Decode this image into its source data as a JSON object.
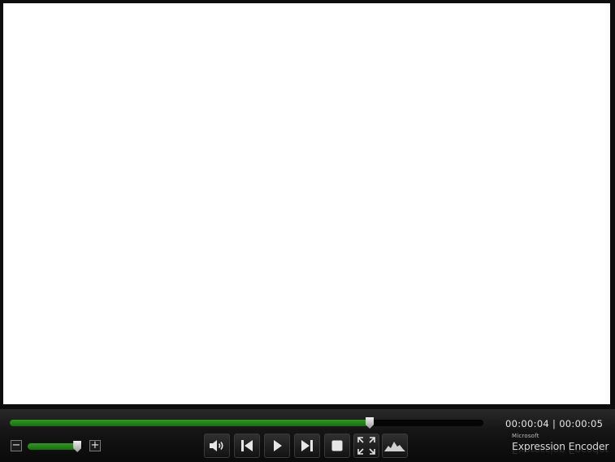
{
  "player": {
    "accent_color": "#2a8f1a",
    "seek": {
      "progress": 0.76
    },
    "time": {
      "current": "00:00:04",
      "separator": "|",
      "total": "00:00:05"
    },
    "volume": {
      "level": 0.9,
      "decrease_symbol": "−",
      "increase_symbol": "+"
    },
    "buttons": [
      {
        "name": "volume-button",
        "icon": "speaker-icon"
      },
      {
        "name": "previous-button",
        "icon": "skip-previous-icon"
      },
      {
        "name": "play-button",
        "icon": "play-icon"
      },
      {
        "name": "next-button",
        "icon": "skip-next-icon"
      },
      {
        "name": "stop-button",
        "icon": "stop-icon"
      },
      {
        "name": "fullscreen-button",
        "icon": "fullscreen-icon"
      },
      {
        "name": "graph-button",
        "icon": "waveform-icon"
      }
    ],
    "brand": {
      "vendor": "Microsoft",
      "product": "Expression Encoder"
    }
  }
}
